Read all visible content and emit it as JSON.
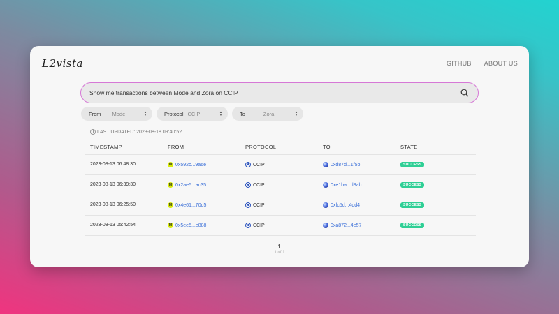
{
  "brand": {
    "logo": "L2vista"
  },
  "nav": {
    "github": "GITHUB",
    "about": "ABOUT US"
  },
  "search": {
    "value": "Show me transactions between Mode and Zora on CCIP"
  },
  "filters": {
    "from": {
      "label": "From",
      "value": "Mode"
    },
    "protocol": {
      "label": "Protocol",
      "value": "CCIP"
    },
    "to": {
      "label": "To",
      "value": "Zora"
    }
  },
  "last_updated": "LAST UPDATED: 2023-08-18 09:40:52",
  "table": {
    "headers": {
      "timestamp": "TIMESTAMP",
      "from": "FROM",
      "protocol": "PROTOCOL",
      "to": "TO",
      "state": "STATE"
    },
    "rows": [
      {
        "timestamp": "2023-08-13 06:48:30",
        "from": "0x592c...9a6e",
        "protocol": "CCIP",
        "to": "0xd87d...1f5b",
        "state": "SUCCESS"
      },
      {
        "timestamp": "2023-08-13 06:39:30",
        "from": "0x2ae5...ac35",
        "protocol": "CCIP",
        "to": "0xe1ba...d8ab",
        "state": "SUCCESS"
      },
      {
        "timestamp": "2023-08-13 06:25:50",
        "from": "0x4e61...70d5",
        "protocol": "CCIP",
        "to": "0xfc5d...4dd4",
        "state": "SUCCESS"
      },
      {
        "timestamp": "2023-08-13 05:42:54",
        "from": "0x5ee5...e888",
        "protocol": "CCIP",
        "to": "0xa872...4e57",
        "state": "SUCCESS"
      }
    ]
  },
  "pagination": {
    "current": "1",
    "summary": "1 of 1"
  },
  "colors": {
    "accent_border": "#d678d6",
    "success": "#2fcf95",
    "link": "#3a6fd8"
  },
  "icons": {
    "from_chain": "mode-icon",
    "protocol": "ccip-icon",
    "to_chain": "zora-icon",
    "search": "search-icon",
    "updated": "clock-icon"
  }
}
